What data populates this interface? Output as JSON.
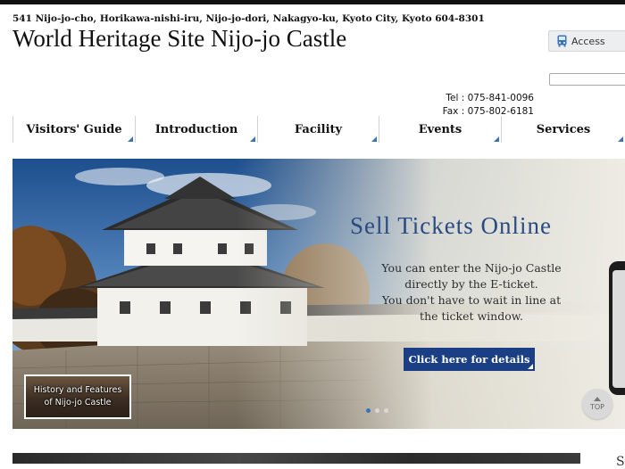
{
  "header": {
    "address": "541 Nijo-jo-cho, Horikawa-nishi-iru, Nijo-jo-dori, Nakagyo-ku, Kyoto City, Kyoto   604-8301",
    "site_title": "World Heritage Site Nijo-jo Castle",
    "access_label": "Access",
    "tel": "Tel : 075-841-0096",
    "fax": "Fax : 075-802-6181"
  },
  "nav": {
    "items": [
      {
        "label": "Visitors' Guide"
      },
      {
        "label": "Introduction"
      },
      {
        "label": "Facility"
      },
      {
        "label": "Events"
      },
      {
        "label": "Services"
      }
    ]
  },
  "hero": {
    "title": "Sell Tickets Online",
    "body_lines": [
      "You can enter the Nijo-jo Castle",
      "directly by the E-ticket.",
      "You don't have to wait in line at",
      "the ticket window."
    ],
    "button_label": "Click here for details",
    "thumbnail_lines": [
      "History and Features",
      "of Nijo-jo Castle"
    ],
    "slide_count": 3,
    "active_slide": 1
  },
  "top_button_label": "TOP",
  "bottom_partial_text": "S",
  "colors": {
    "nav_accent": "#3a74b8",
    "hero_title": "#2a4a82",
    "button_bg": "#1a3f85"
  }
}
